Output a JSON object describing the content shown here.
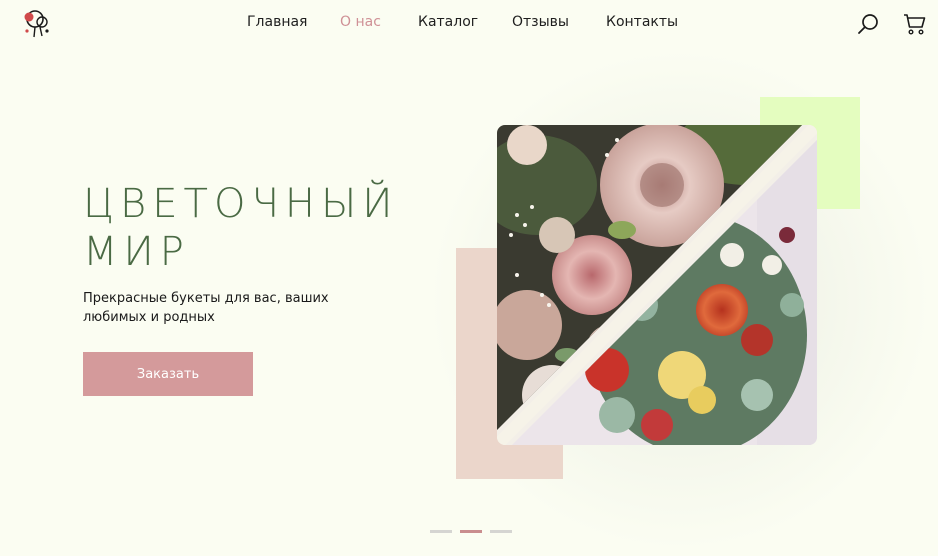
{
  "nav": {
    "items": [
      {
        "label": "Главная",
        "active": false
      },
      {
        "label": "О нас",
        "active": true
      },
      {
        "label": "Каталог",
        "active": false
      },
      {
        "label": "Отзывы",
        "active": false
      },
      {
        "label": "Контакты",
        "active": false
      }
    ],
    "search_icon": "search-icon",
    "cart_icon": "cart-icon"
  },
  "hero": {
    "title_line1": "Цветочный",
    "title_line2": "мир",
    "subtitle": "Прекрасные букеты для вас, ваших любимых и родных",
    "order_label": "Заказать"
  },
  "slider": {
    "slides": 3,
    "active_index": 1
  },
  "colors": {
    "background": "#fbfdf2",
    "accent": "#d49a9b",
    "title": "#4a6a44",
    "deco_green": "#e4fdbf",
    "deco_pink": "#ebd6cb"
  }
}
